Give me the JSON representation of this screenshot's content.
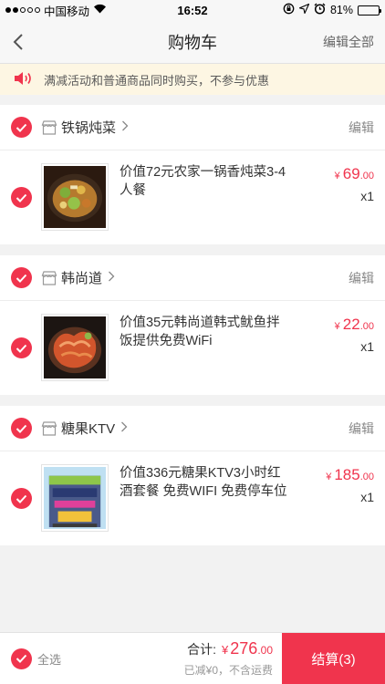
{
  "status": {
    "carrier": "中国移动",
    "time": "16:52",
    "battery_pct": "81%",
    "battery_level": 0.81,
    "icons": [
      "wifi-icon",
      "lock-rotation-icon",
      "location-icon",
      "alarm-icon",
      "battery-icon"
    ]
  },
  "header": {
    "title": "购物车",
    "edit_all": "编辑全部"
  },
  "notice": {
    "text": "满减活动和普通商品同时购买，不参与优惠",
    "icon": "speaker-icon"
  },
  "groups": [
    {
      "shop": "铁锅炖菜",
      "edit": "编辑",
      "item": {
        "title": "价值72元农家一锅香炖菜3-4人餐",
        "currency": "¥",
        "price_int": "69",
        "price_dec": ".00",
        "qty": "x1"
      }
    },
    {
      "shop": "韩尚道",
      "edit": "编辑",
      "item": {
        "title": "价值35元韩尚道韩式鱿鱼拌饭提供免费WiFi",
        "currency": "¥",
        "price_int": "22",
        "price_dec": ".00",
        "qty": "x1"
      }
    },
    {
      "shop": "糖果KTV",
      "edit": "编辑",
      "item": {
        "title": "价值336元糖果KTV3小时红酒套餐 免费WIFI 免费停车位",
        "currency": "¥",
        "price_int": "185",
        "price_dec": ".00",
        "qty": "x1"
      }
    }
  ],
  "footer": {
    "select_all": "全选",
    "total_label": "合计:",
    "currency": "¥",
    "total_int": "276",
    "total_dec": ".00",
    "discount_note": "已减¥0，不含运费",
    "checkout": "结算(3)"
  },
  "colors": {
    "accent": "#f0344d",
    "notice_bg": "#fdf6e3",
    "page_bg": "#f2f2f2"
  }
}
